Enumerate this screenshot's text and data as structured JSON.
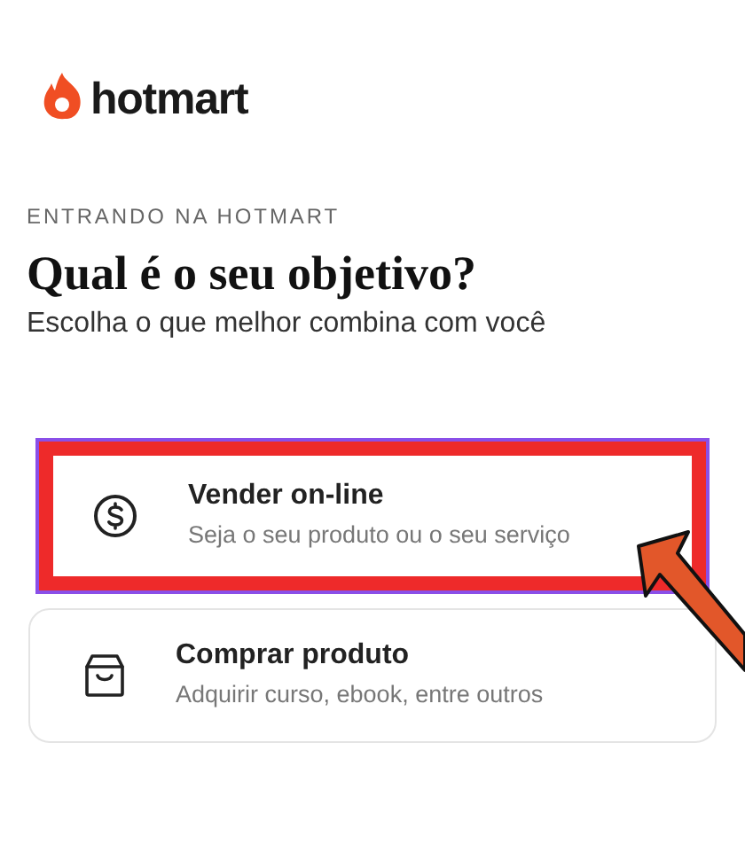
{
  "logo": {
    "text": "hotmart"
  },
  "eyebrow": "ENTRANDO NA HOTMART",
  "title": "Qual é o seu objetivo?",
  "subtitle": "Escolha o que melhor combina com você",
  "options": [
    {
      "kind": "sell",
      "title": "Vender on-line",
      "description": "Seja o seu produto ou o seu serviço",
      "selected": true
    },
    {
      "kind": "buy",
      "title": "Comprar produto",
      "description": "Adquirir curso, ebook, entre outros",
      "selected": false
    }
  ]
}
